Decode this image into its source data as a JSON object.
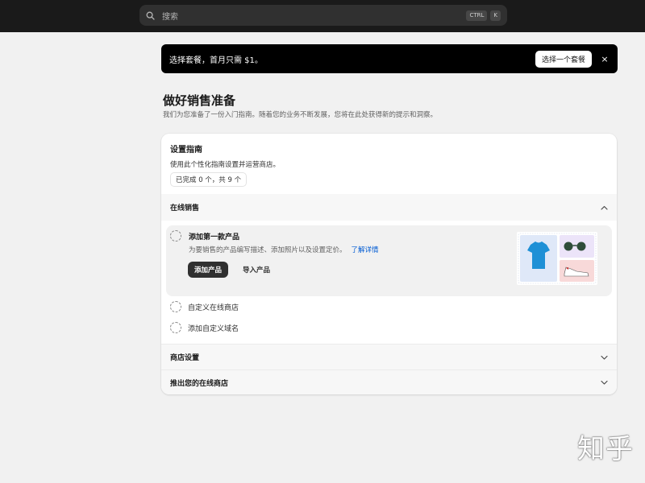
{
  "topbar": {
    "search_placeholder": "搜索",
    "shortcut_keys": [
      "CTRL",
      "K"
    ]
  },
  "banner": {
    "text": "选择套餐，首月只需 $1。",
    "button_label": "选择一个套餐",
    "close_icon": "×"
  },
  "heading": {
    "title": "做好销售准备",
    "subtitle": "我们为您准备了一份入门指南。随着您的业务不断发展，您将在此处获得新的提示和洞察。"
  },
  "setup_guide": {
    "title": "设置指南",
    "description": "使用此个性化指南设置并运营商店。",
    "progress": "已完成 0 个，共 9 个",
    "progress_fraction": 0.0,
    "sections": [
      {
        "label": "在线销售",
        "expanded": true,
        "active_task": {
          "title": "添加第一款产品",
          "description": "为要销售的产品编写描述、添加照片以及设置定价。",
          "link": "了解详情",
          "primary_button": "添加产品",
          "secondary_button": "导入产品"
        },
        "tasks": [
          "自定义在线商店",
          "添加自定义域名"
        ]
      },
      {
        "label": "商店设置",
        "expanded": false
      },
      {
        "label": "推出您的在线商店",
        "expanded": false
      }
    ]
  },
  "watermark": "知乎",
  "colors": {
    "topbar": "#1a1a1a",
    "banner": "#000000",
    "page_bg": "#f1f1f1",
    "link": "#005bd3",
    "primary_button": "#303030",
    "tshirt": "#1e90d6"
  }
}
